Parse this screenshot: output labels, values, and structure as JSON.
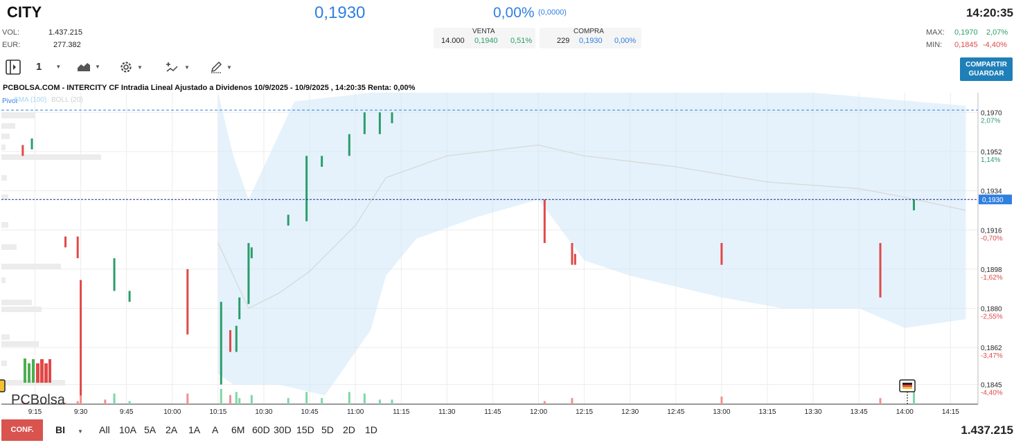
{
  "header": {
    "ticker": "CITY",
    "price": "0,1930",
    "change_pct": "0,00%",
    "change_abs": "(0,0000)",
    "time": "14:20:35"
  },
  "stats": {
    "vol_label": "VOL:",
    "vol_value": "1.437.215",
    "eur_label": "EUR:",
    "eur_value": "277.382",
    "max_label": "MAX:",
    "max_value": "0,1970",
    "max_pct": "2,07%",
    "min_label": "MIN:",
    "min_value": "0,1845",
    "min_pct": "-4,40%"
  },
  "orderbook": {
    "venta_label": "VENTA",
    "venta_qty": "14.000",
    "venta_price": "0,1940",
    "venta_pct": "0,51%",
    "compra_label": "COMPRA",
    "compra_qty": "229",
    "compra_price": "0,1930",
    "compra_pct": "0,00%"
  },
  "toolbar": {
    "interval": "1",
    "share_line1": "COMPARTIR",
    "share_line2": "GUARDAR"
  },
  "chart_title": "PCBOLSA.COM - INTERCITY CF Intradia Lineal Ajustado a Dividenos 10/9/2025 - 10/9/2025 , 14:20:35 Renta: 0,00%",
  "indicators": {
    "pivot": "Pivot",
    "sma": "SMA (100)",
    "boll": "BOLL (20)"
  },
  "logo": "PCBolsa",
  "bottom": {
    "conf": "CONF.",
    "mode": "BI",
    "ranges": [
      "All",
      "10A",
      "5A",
      "2A",
      "1A",
      "A",
      "6M",
      "60D",
      "30D",
      "15D",
      "5D",
      "2D",
      "1D"
    ],
    "volume": "1.437.215"
  },
  "colors": {
    "up": "#2a9d6a",
    "down": "#e04848",
    "accent": "#2f7fe0",
    "band": "#cfe8f8"
  },
  "chart_data": {
    "type": "bar",
    "ylim": [
      0.1836,
      0.1979
    ],
    "xlim": [
      "9:04",
      "14:24"
    ],
    "xticks": [
      "9:15",
      "9:30",
      "9:45",
      "10:00",
      "10:15",
      "10:30",
      "10:45",
      "11:00",
      "11:15",
      "11:30",
      "11:45",
      "12:00",
      "12:15",
      "12:30",
      "12:45",
      "13:00",
      "13:15",
      "13:30",
      "13:45",
      "14:00",
      "14:15"
    ],
    "yticks": [
      {
        "v": 0.197,
        "label": "0,1970",
        "pct": "2,07%"
      },
      {
        "v": 0.1952,
        "label": "0,1952",
        "pct": "1,14%"
      },
      {
        "v": 0.1934,
        "label": "0,1934",
        "pct": "0,23%"
      },
      {
        "v": 0.1916,
        "label": "0,1916",
        "pct": "-0,70%"
      },
      {
        "v": 0.1898,
        "label": "0,1898",
        "pct": "-1,62%"
      },
      {
        "v": 0.188,
        "label": "0,1880",
        "pct": "-2,55%"
      },
      {
        "v": 0.1862,
        "label": "0,1862",
        "pct": "-3,47%"
      },
      {
        "v": 0.1845,
        "label": "0,1845",
        "pct": "-4,40%"
      }
    ],
    "last": {
      "v": 0.193,
      "label": "0,1930"
    },
    "pivot": 0.1971,
    "bars": [
      {
        "t": "9:11",
        "lo": 0.195,
        "hi": 0.1955,
        "dir": "down"
      },
      {
        "t": "9:14",
        "lo": 0.1953,
        "hi": 0.1958,
        "dir": "up"
      },
      {
        "t": "9:25",
        "lo": 0.1908,
        "hi": 0.1913,
        "dir": "down"
      },
      {
        "t": "9:29",
        "lo": 0.1903,
        "hi": 0.1913,
        "dir": "down"
      },
      {
        "t": "9:30",
        "lo": 0.184,
        "hi": 0.1893,
        "dir": "down"
      },
      {
        "t": "9:41",
        "lo": 0.1888,
        "hi": 0.1903,
        "dir": "up"
      },
      {
        "t": "9:46",
        "lo": 0.1883,
        "hi": 0.1888,
        "dir": "up"
      },
      {
        "t": "10:05",
        "lo": 0.1868,
        "hi": 0.1898,
        "dir": "down"
      },
      {
        "t": "10:16",
        "lo": 0.1845,
        "hi": 0.1883,
        "dir": "up"
      },
      {
        "t": "10:19",
        "lo": 0.186,
        "hi": 0.187,
        "dir": "down"
      },
      {
        "t": "10:21",
        "lo": 0.186,
        "hi": 0.1872,
        "dir": "up"
      },
      {
        "t": "10:22",
        "lo": 0.1875,
        "hi": 0.1885,
        "dir": "up"
      },
      {
        "t": "10:25",
        "lo": 0.1882,
        "hi": 0.191,
        "dir": "up"
      },
      {
        "t": "10:26",
        "lo": 0.1903,
        "hi": 0.1908,
        "dir": "up"
      },
      {
        "t": "10:38",
        "lo": 0.1918,
        "hi": 0.1923,
        "dir": "up"
      },
      {
        "t": "10:44",
        "lo": 0.192,
        "hi": 0.195,
        "dir": "up"
      },
      {
        "t": "10:49",
        "lo": 0.1945,
        "hi": 0.195,
        "dir": "up"
      },
      {
        "t": "10:58",
        "lo": 0.195,
        "hi": 0.196,
        "dir": "up"
      },
      {
        "t": "11:03",
        "lo": 0.196,
        "hi": 0.197,
        "dir": "up"
      },
      {
        "t": "11:08",
        "lo": 0.196,
        "hi": 0.197,
        "dir": "up"
      },
      {
        "t": "11:12",
        "lo": 0.1965,
        "hi": 0.197,
        "dir": "up"
      },
      {
        "t": "12:02",
        "lo": 0.191,
        "hi": 0.193,
        "dir": "down"
      },
      {
        "t": "12:11",
        "lo": 0.19,
        "hi": 0.191,
        "dir": "down"
      },
      {
        "t": "12:12",
        "lo": 0.19,
        "hi": 0.1905,
        "dir": "down"
      },
      {
        "t": "13:00",
        "lo": 0.19,
        "hi": 0.191,
        "dir": "down"
      },
      {
        "t": "13:52",
        "lo": 0.1885,
        "hi": 0.191,
        "dir": "down"
      },
      {
        "t": "14:03",
        "lo": 0.1925,
        "hi": 0.193,
        "dir": "up"
      }
    ],
    "bollinger_upper": [
      [
        "10:15",
        0.198
      ],
      [
        "10:20",
        0.195
      ],
      [
        "10:25",
        0.193
      ],
      [
        "10:40",
        0.1975
      ],
      [
        "11:05",
        0.1985
      ],
      [
        "12:00",
        0.1985
      ],
      [
        "13:00",
        0.1985
      ],
      [
        "13:30",
        0.198
      ],
      [
        "14:20",
        0.1973
      ]
    ],
    "bollinger_lower": [
      [
        "10:15",
        0.185
      ],
      [
        "10:20",
        0.1845
      ],
      [
        "10:35",
        0.1845
      ],
      [
        "10:50",
        0.184
      ],
      [
        "11:05",
        0.187
      ],
      [
        "11:10",
        0.1895
      ],
      [
        "11:20",
        0.1912
      ],
      [
        "11:40",
        0.1922
      ],
      [
        "12:00",
        0.193
      ],
      [
        "12:15",
        0.1902
      ],
      [
        "12:30",
        0.1895
      ],
      [
        "13:00",
        0.1885
      ],
      [
        "13:20",
        0.188
      ],
      [
        "13:45",
        0.188
      ],
      [
        "14:00",
        0.1871
      ],
      [
        "14:20",
        0.1875
      ]
    ],
    "sma": [
      [
        "10:15",
        0.191
      ],
      [
        "10:25",
        0.188
      ],
      [
        "10:35",
        0.1887
      ],
      [
        "10:45",
        0.1897
      ],
      [
        "11:00",
        0.1918
      ],
      [
        "11:10",
        0.194
      ],
      [
        "11:30",
        0.195
      ],
      [
        "12:00",
        0.1955
      ],
      [
        "12:15",
        0.195
      ],
      [
        "12:45",
        0.1945
      ],
      [
        "13:15",
        0.1938
      ],
      [
        "13:45",
        0.1935
      ],
      [
        "14:00",
        0.1931
      ],
      [
        "14:20",
        0.1925
      ]
    ],
    "volume": [
      {
        "t": "9:11",
        "v": 0.2,
        "dir": "down"
      },
      {
        "t": "9:25",
        "v": 0.1,
        "dir": "down"
      },
      {
        "t": "9:29",
        "v": 0.2,
        "dir": "down"
      },
      {
        "t": "9:30",
        "v": 1.0,
        "dir": "down"
      },
      {
        "t": "9:38",
        "v": 0.3,
        "dir": "down"
      },
      {
        "t": "9:41",
        "v": 0.7,
        "dir": "up"
      },
      {
        "t": "9:46",
        "v": 0.2,
        "dir": "up"
      },
      {
        "t": "10:05",
        "v": 0.7,
        "dir": "down"
      },
      {
        "t": "10:16",
        "v": 1.0,
        "dir": "up"
      },
      {
        "t": "10:19",
        "v": 0.6,
        "dir": "down"
      },
      {
        "t": "10:21",
        "v": 0.8,
        "dir": "up"
      },
      {
        "t": "10:22",
        "v": 0.4,
        "dir": "up"
      },
      {
        "t": "10:26",
        "v": 0.6,
        "dir": "up"
      },
      {
        "t": "10:38",
        "v": 0.4,
        "dir": "up"
      },
      {
        "t": "10:44",
        "v": 0.8,
        "dir": "up"
      },
      {
        "t": "10:49",
        "v": 0.4,
        "dir": "up"
      },
      {
        "t": "10:58",
        "v": 0.8,
        "dir": "up"
      },
      {
        "t": "11:03",
        "v": 0.7,
        "dir": "up"
      },
      {
        "t": "11:08",
        "v": 0.3,
        "dir": "up"
      },
      {
        "t": "11:12",
        "v": 0.3,
        "dir": "up"
      },
      {
        "t": "12:02",
        "v": 0.2,
        "dir": "down"
      },
      {
        "t": "12:11",
        "v": 0.4,
        "dir": "down"
      },
      {
        "t": "13:00",
        "v": 0.5,
        "dir": "down"
      },
      {
        "t": "13:52",
        "v": 0.4,
        "dir": "down"
      },
      {
        "t": "14:03",
        "v": 0.8,
        "dir": "up"
      }
    ]
  }
}
